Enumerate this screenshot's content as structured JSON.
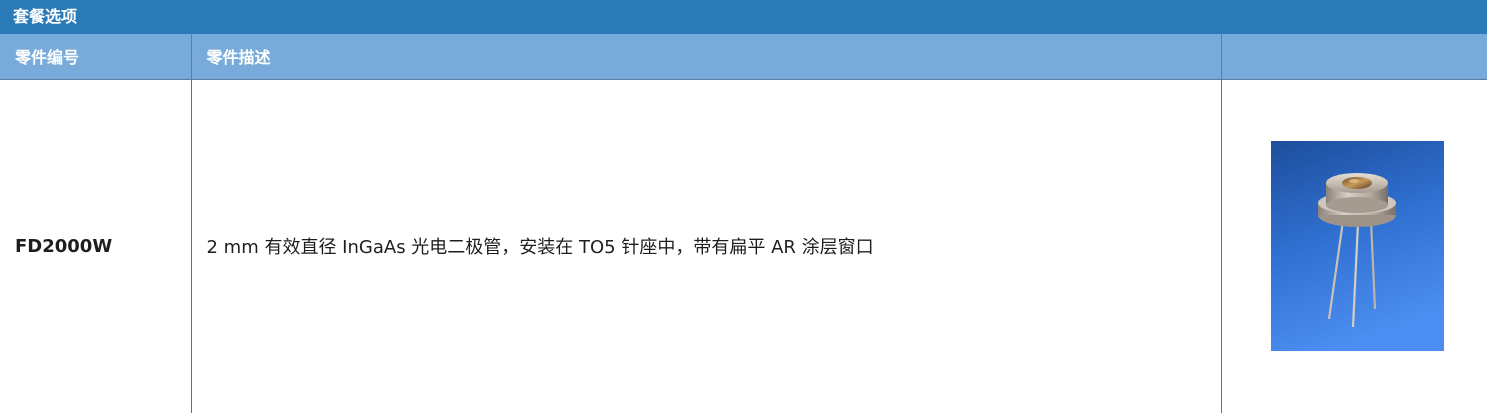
{
  "section": {
    "title": "套餐选项"
  },
  "table": {
    "headers": [
      "零件编号",
      "零件描述",
      ""
    ],
    "rows": [
      {
        "part_number": "FD2000W",
        "description": "2 mm 有效直径 InGaAs 光电二极管，安装在 TO5 针座中，带有扁平 AR 涂层窗口",
        "image_icon": "photodiode-to5-photo"
      }
    ]
  },
  "colors": {
    "header_bar": "#2a7ab8",
    "column_header": "#78abd9",
    "photo_background": "#2f6fd0"
  }
}
